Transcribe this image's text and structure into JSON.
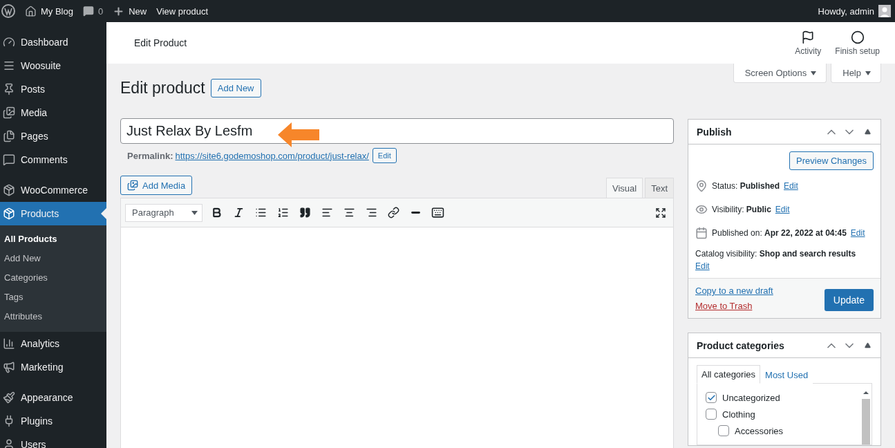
{
  "admin_bar": {
    "site": "My Blog",
    "comments": "0",
    "new": "New",
    "view": "View product",
    "greeting": "Howdy, admin"
  },
  "sidebar": {
    "groups": [
      {
        "items": [
          {
            "kind": "dashboard",
            "label": "Dashboard",
            "selected": false
          },
          {
            "kind": "woosuite",
            "label": "Woosuite",
            "selected": false
          },
          {
            "kind": "posts",
            "label": "Posts",
            "selected": false
          },
          {
            "kind": "media",
            "label": "Media",
            "selected": false
          },
          {
            "kind": "pages",
            "label": "Pages",
            "selected": false
          },
          {
            "kind": "comments",
            "label": "Comments",
            "selected": false
          }
        ]
      },
      {
        "items": [
          {
            "kind": "woo",
            "label": "WooCommerce",
            "selected": false
          },
          {
            "kind": "products",
            "label": "Products",
            "selected": true,
            "children": [
              {
                "label": "All Products",
                "selected": true
              },
              {
                "label": "Add New",
                "selected": false
              },
              {
                "label": "Categories",
                "selected": false
              },
              {
                "label": "Tags",
                "selected": false
              },
              {
                "label": "Attributes",
                "selected": false
              }
            ]
          },
          {
            "kind": "analytics",
            "label": "Analytics",
            "selected": false
          },
          {
            "kind": "marketing",
            "label": "Marketing",
            "selected": false
          }
        ]
      },
      {
        "items": [
          {
            "kind": "appearance",
            "label": "Appearance",
            "selected": false
          },
          {
            "kind": "plugins",
            "label": "Plugins",
            "selected": false
          },
          {
            "kind": "users",
            "label": "Users",
            "selected": false
          }
        ]
      }
    ]
  },
  "header": {
    "title": "Edit Product",
    "actions": [
      {
        "kind": "activity",
        "label": "Activity"
      },
      {
        "kind": "setup",
        "label": "Finish setup"
      }
    ]
  },
  "screen_tabs": [
    "Screen Options",
    "Help"
  ],
  "page": {
    "title": "Edit product",
    "add_new": "Add New"
  },
  "product_title": {
    "value": "Just Relax By Lesfm"
  },
  "permalink": {
    "label": "Permalink:",
    "url": "https://site6.godemoshop.com/product/just-relax/",
    "edit": "Edit"
  },
  "editor": {
    "add_media": "Add Media",
    "tabs": [
      {
        "label": "Visual",
        "selected": true
      },
      {
        "label": "Text",
        "selected": false
      }
    ],
    "format": "Paragraph"
  },
  "publish": {
    "title": "Publish",
    "preview": "Preview Changes",
    "rows": [
      {
        "kind": "status",
        "label": "Status:",
        "value": "Published",
        "edit": "Edit"
      },
      {
        "kind": "visibility",
        "label": "Visibility:",
        "value": "Public",
        "edit": "Edit"
      },
      {
        "kind": "date",
        "label": "Published on:",
        "value": "Apr 22, 2022 at 04:45",
        "edit": "Edit"
      },
      {
        "kind": "catalog",
        "label": "Catalog visibility:",
        "value": "Shop and search results",
        "edit": "Edit"
      }
    ],
    "copy": "Copy to a new draft",
    "trash": "Move to Trash",
    "update": "Update"
  },
  "categories": {
    "title": "Product categories",
    "tabs": [
      {
        "label": "All categories",
        "selected": true
      },
      {
        "label": "Most Used",
        "selected": false
      }
    ],
    "items": [
      {
        "label": "Uncategorized",
        "checked": true
      },
      {
        "label": "Clothing",
        "checked": false,
        "children": [
          {
            "label": "Accessories",
            "checked": false
          }
        ]
      }
    ]
  }
}
